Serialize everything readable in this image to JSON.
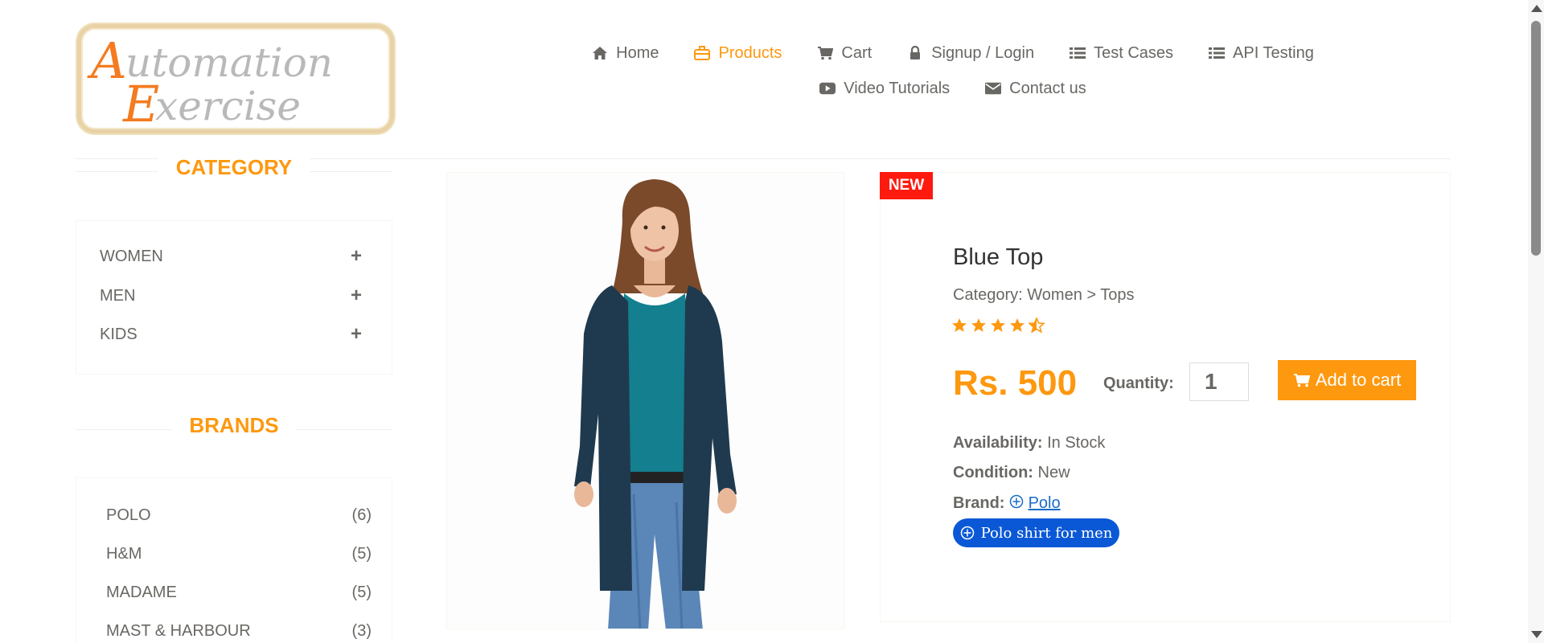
{
  "logo": {
    "line1": "Automation",
    "line2": "Exercise"
  },
  "nav": [
    {
      "label": "Home",
      "icon": "home-icon"
    },
    {
      "label": "Products",
      "icon": "briefcase-icon",
      "active": true
    },
    {
      "label": "Cart",
      "icon": "cart-icon"
    },
    {
      "label": "Signup / Login",
      "icon": "lock-icon"
    },
    {
      "label": "Test Cases",
      "icon": "list-icon"
    },
    {
      "label": "API Testing",
      "icon": "list-icon"
    },
    {
      "label": "Video Tutorials",
      "icon": "youtube-play-icon"
    },
    {
      "label": "Contact us",
      "icon": "envelope-icon"
    }
  ],
  "sidebar": {
    "category_title": "CATEGORY",
    "categories": [
      {
        "label": "WOMEN",
        "toggle": "+"
      },
      {
        "label": "MEN",
        "toggle": "+"
      },
      {
        "label": "KIDS",
        "toggle": "+"
      }
    ],
    "brands_title": "BRANDS",
    "brands": [
      {
        "name": "POLO",
        "count": "(6)"
      },
      {
        "name": "H&M",
        "count": "(5)"
      },
      {
        "name": "MADAME",
        "count": "(5)"
      },
      {
        "name": "MAST & HARBOUR",
        "count": "(3)"
      }
    ]
  },
  "product": {
    "badge": "NEW",
    "name": "Blue Top",
    "category": "Category: Women > Tops",
    "rating": 4.5,
    "price": "Rs. 500",
    "quantity_label": "Quantity:",
    "quantity_value": "1",
    "add_to_cart": "Add to cart",
    "availability_label": "Availability:",
    "availability_value": "In Stock",
    "condition_label": "Condition:",
    "condition_value": "New",
    "brand_label": "Brand:",
    "brand_value": "Polo",
    "polo_link": "Polo shirt for men"
  },
  "colors": {
    "accent": "#fe980f",
    "text": "#696763",
    "badge": "#fe1a0f",
    "link_pill": "#0a58d6"
  }
}
